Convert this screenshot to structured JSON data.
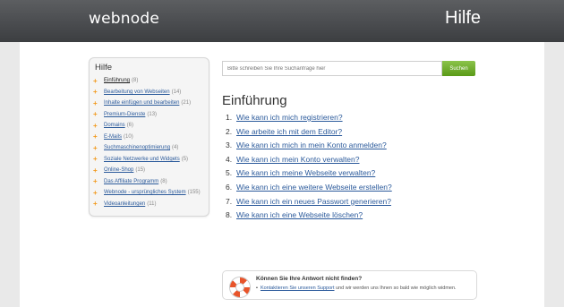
{
  "header": {
    "logo": "webnode",
    "title": "Hilfe"
  },
  "sidebar": {
    "heading": "Hilfe",
    "items": [
      {
        "label": "Einführung",
        "count": "(8)"
      },
      {
        "label": "Bearbeitung von Webseiten",
        "count": "(14)"
      },
      {
        "label": "Inhalte einfügen und bearbeiten",
        "count": "(21)"
      },
      {
        "label": "Premium-Dienste",
        "count": "(13)"
      },
      {
        "label": "Domains",
        "count": "(6)"
      },
      {
        "label": "E-Mails",
        "count": "(10)"
      },
      {
        "label": "Suchmaschinenoptimierung",
        "count": "(4)"
      },
      {
        "label": "Soziale Netzwerke und Widgets",
        "count": "(5)"
      },
      {
        "label": "Online-Shop",
        "count": "(15)"
      },
      {
        "label": "Das Affiliate Programm",
        "count": "(8)"
      },
      {
        "label": "Webnode - ursprüngliches System",
        "count": "(155)"
      },
      {
        "label": "Videoanleitungen",
        "count": "(11)"
      }
    ]
  },
  "search": {
    "placeholder": "Bitte schreiben Sie Ihre Suchanfrage hier",
    "button": "Suchen"
  },
  "main": {
    "title": "Einführung",
    "questions": [
      {
        "num": "1.",
        "text": "Wie kann ich mich registrieren?"
      },
      {
        "num": "2.",
        "text": "Wie arbeite ich mit dem Editor?"
      },
      {
        "num": "3.",
        "text": "Wie kann ich mich in mein Konto anmelden?"
      },
      {
        "num": "4.",
        "text": "Wie kann ich mein Konto verwalten?"
      },
      {
        "num": "5.",
        "text": "Wie kann ich meine Webseite verwalten?"
      },
      {
        "num": "6.",
        "text": "Wie kann ich eine weitere Webseite erstellen?"
      },
      {
        "num": "7.",
        "text": "Wie kann ich ein neues Passwort generieren?"
      },
      {
        "num": "8.",
        "text": "Wie kann ich eine Webseite löschen?"
      }
    ]
  },
  "support": {
    "title": "Können Sie Ihre Antwort nicht finden?",
    "link": "Kontaktieren Sie unseren Support",
    "text": " und wir werden uns Ihnen so bald wie möglich widmen."
  },
  "colors": {
    "accent": "#f29a1e",
    "link": "#2b5a9b",
    "button": "#6aaa22",
    "header": "#4a4c4f"
  }
}
